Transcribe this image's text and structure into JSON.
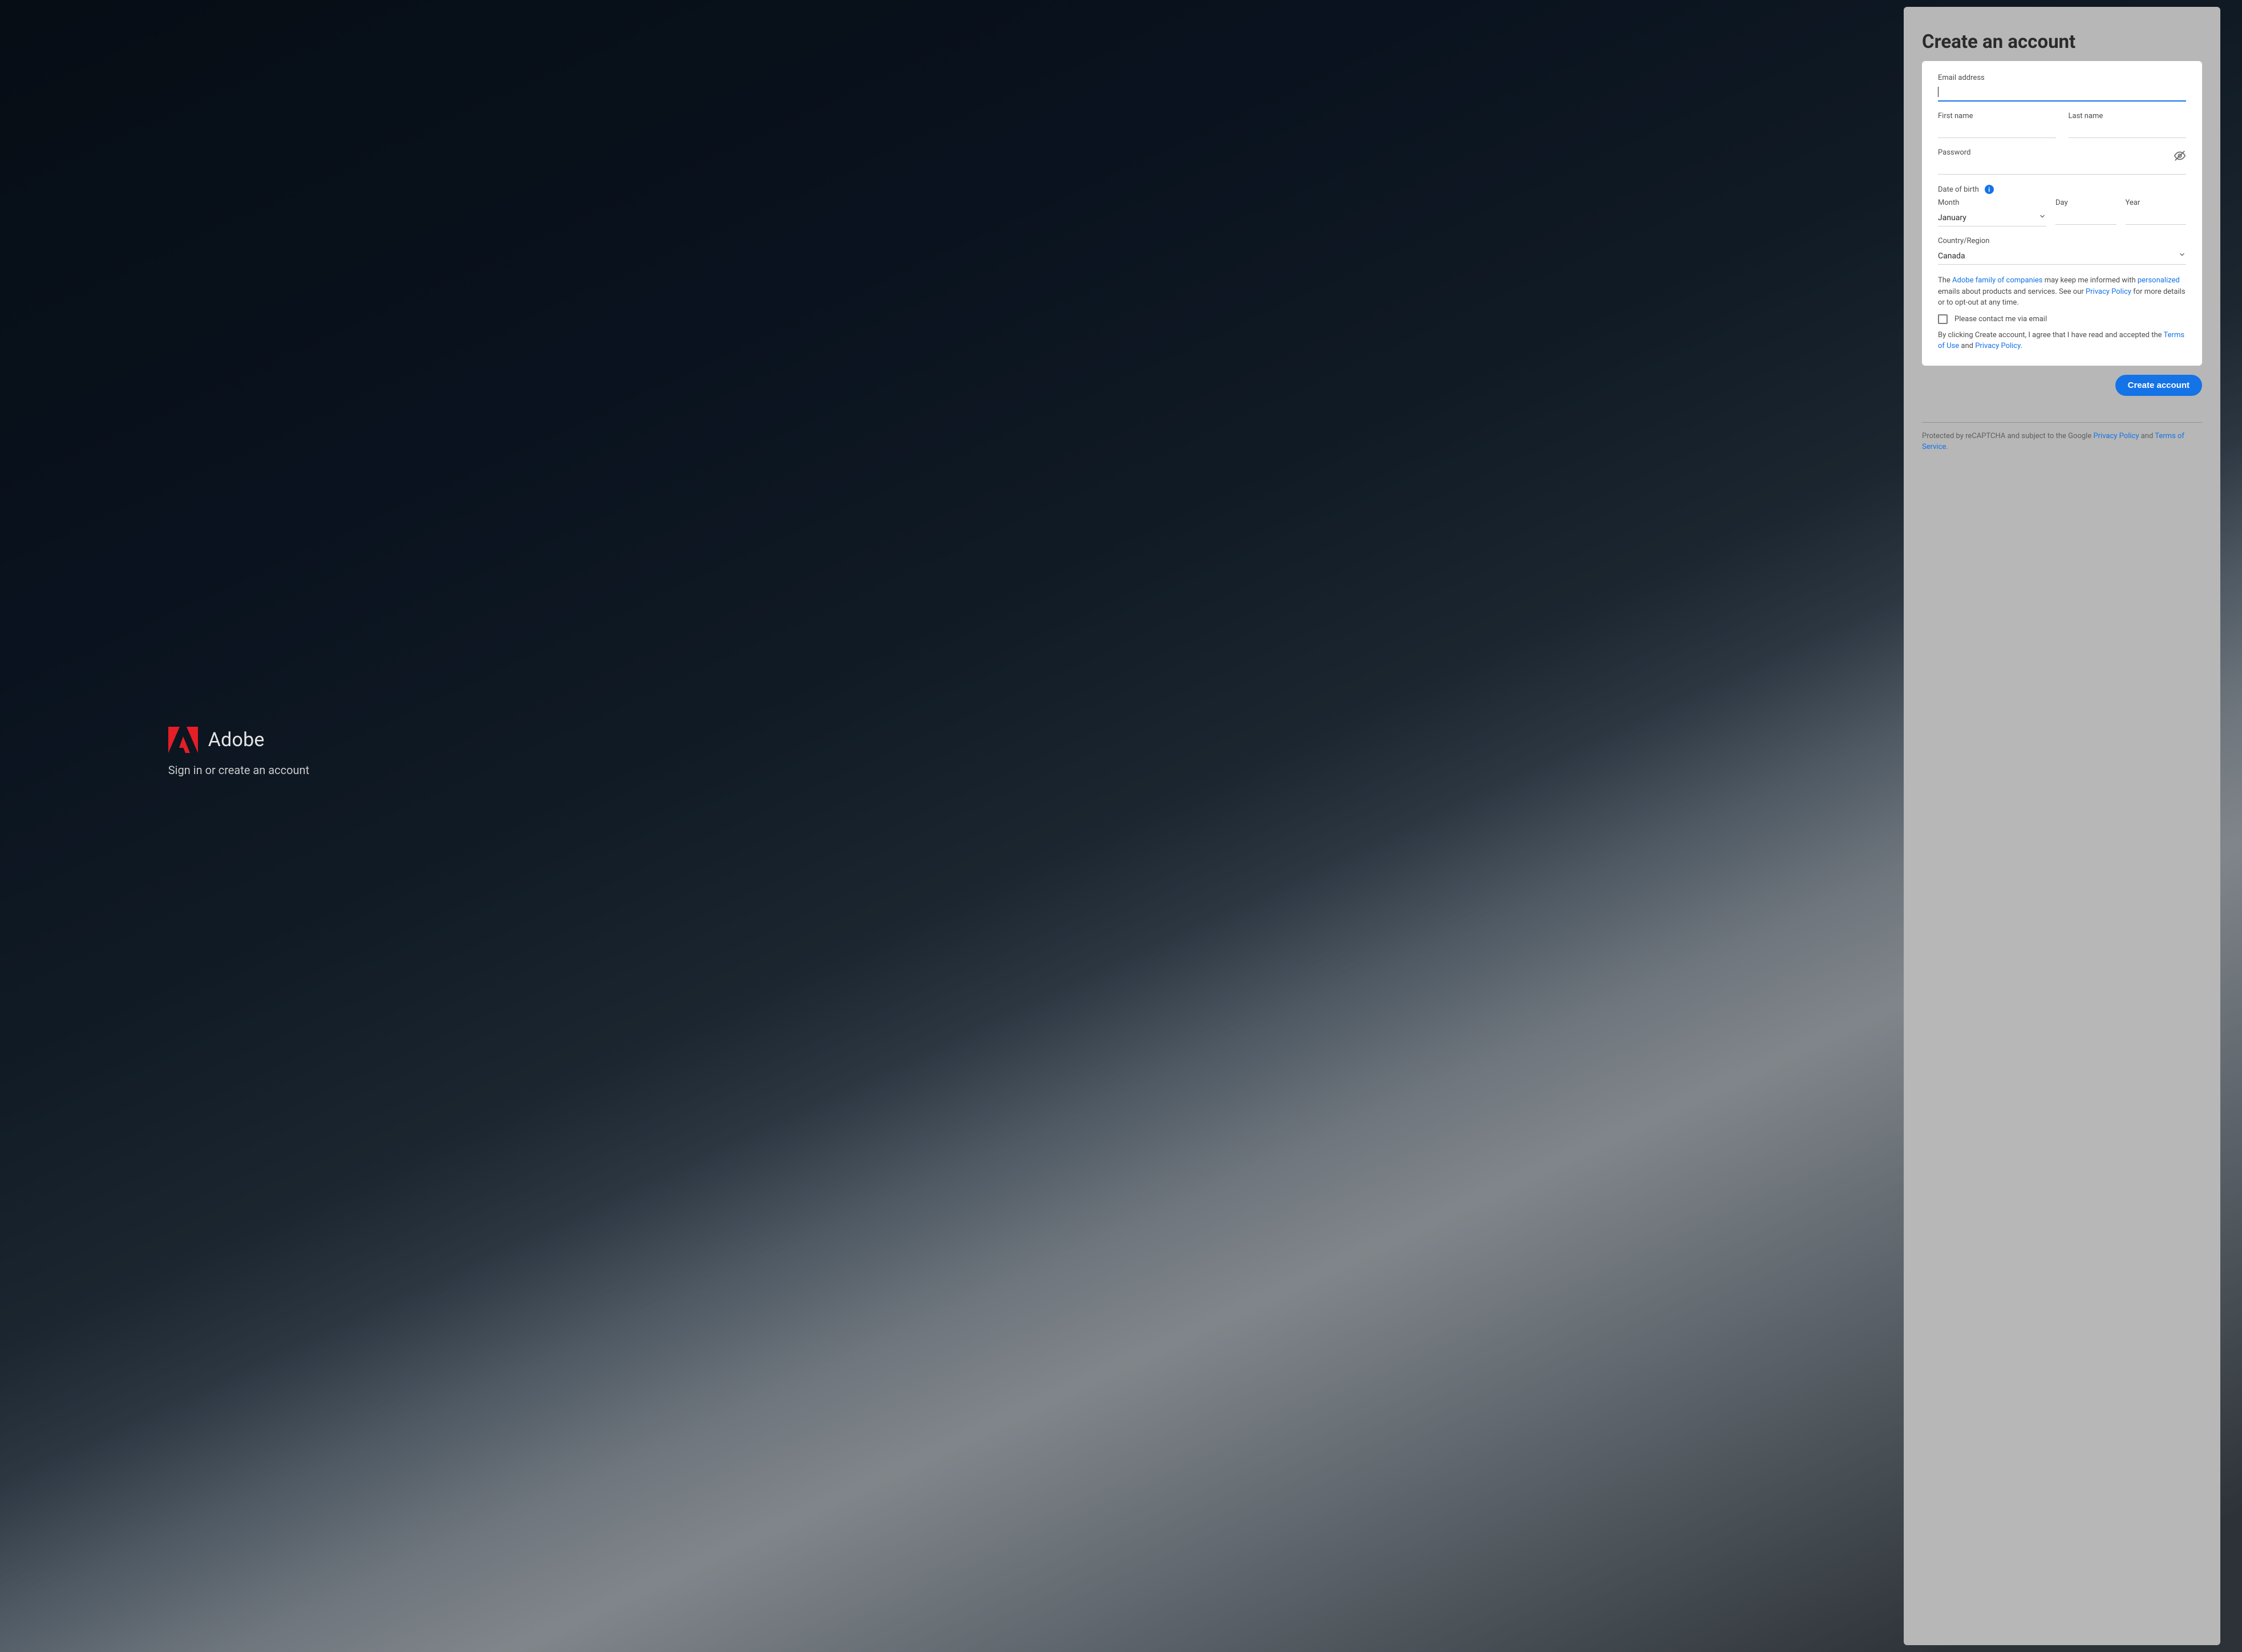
{
  "brand": {
    "name": "Adobe",
    "tagline": "Sign in or create an account",
    "accent_color": "#e61e27"
  },
  "panel": {
    "title": "Create an account"
  },
  "form": {
    "email_label": "Email address",
    "email_value": "",
    "first_name_label": "First name",
    "first_name_value": "",
    "last_name_label": "Last name",
    "last_name_value": "",
    "password_label": "Password",
    "password_value": "",
    "dob_label": "Date of birth",
    "month_label": "Month",
    "month_value": "January",
    "day_label": "Day",
    "day_value": "",
    "year_label": "Year",
    "year_value": "",
    "country_label": "Country/Region",
    "country_value": "Canada"
  },
  "legal": {
    "intro_prefix": "The ",
    "adobe_family_link": "Adobe family of companies",
    "intro_mid1": " may keep me informed with ",
    "personalized_link": "personalized",
    "intro_mid2": " emails about products and services. See our ",
    "privacy_policy_link": "Privacy Policy",
    "intro_suffix": " for more details or to opt-out at any time.",
    "contact_checkbox_label": "Please contact me via email",
    "agree_prefix": "By clicking Create account, I agree that I have read and accepted the ",
    "terms_link": "Terms of Use",
    "agree_and": " and ",
    "privacy_link2": "Privacy Policy",
    "agree_suffix": "."
  },
  "actions": {
    "submit_label": "Create account"
  },
  "footer": {
    "recaptcha_prefix": "Protected by reCAPTCHA and subject to the Google ",
    "privacy_link": "Privacy Policy",
    "and": " and ",
    "tos_link": "Terms of Service",
    "suffix": "."
  }
}
